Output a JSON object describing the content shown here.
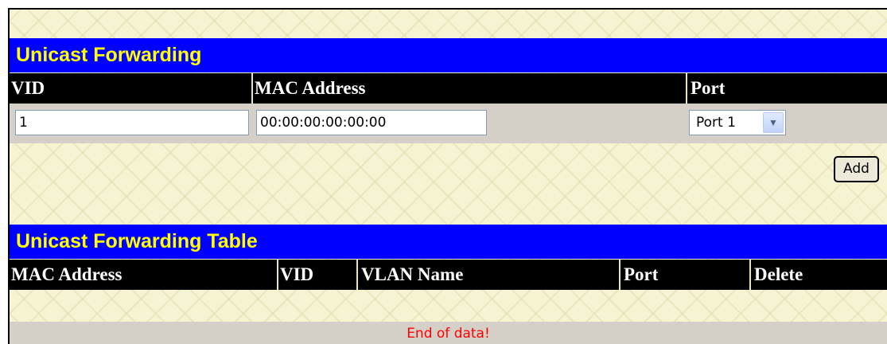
{
  "unicast_forwarding": {
    "title": "Unicast Forwarding",
    "columns": [
      "VID",
      "MAC Address",
      "Port"
    ],
    "vid_value": "1",
    "mac_value": "00:00:00:00:00:00",
    "port_selected": "Port 1",
    "add_label": "Add"
  },
  "unicast_forwarding_table": {
    "title": "Unicast Forwarding Table",
    "columns": [
      "MAC Address",
      "VID",
      "VLAN Name",
      "Port",
      "Delete"
    ],
    "empty_message": "End of data!"
  },
  "colors": {
    "title_bar_bg": "#0000ff",
    "title_bar_text": "#ffff00",
    "header_bg": "#000000",
    "header_text": "#ffffff",
    "row_bg": "#d4d0c8",
    "empty_text": "#ff0000",
    "page_bg": "#f6f3d3"
  }
}
